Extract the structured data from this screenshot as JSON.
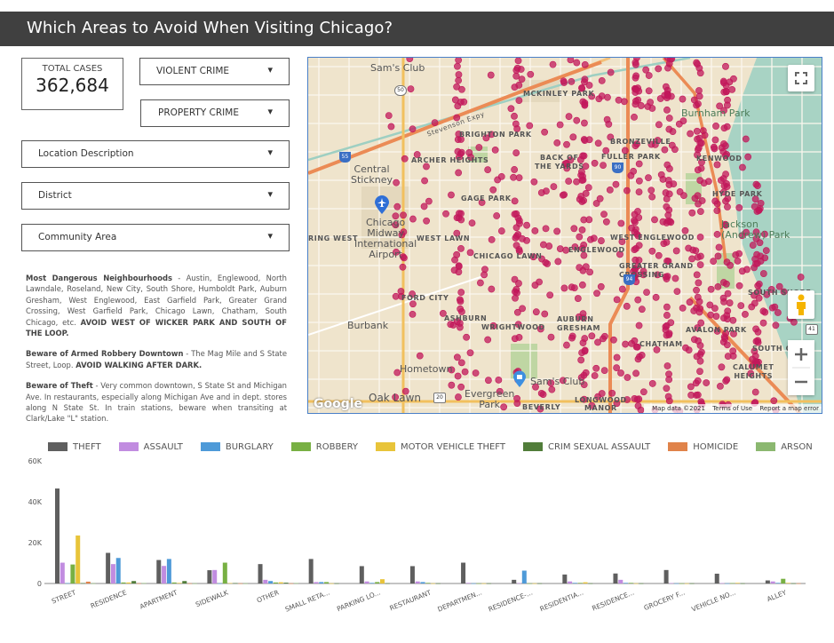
{
  "header": {
    "title": "Which Areas to Avoid When Visiting Chicago?"
  },
  "kpi": {
    "label": "TOTAL CASES",
    "value": "362,684"
  },
  "filters": {
    "violent_crime": {
      "label": "VIOLENT CRIME",
      "chevron": "▾"
    },
    "property_crime": {
      "label": "PROPERTY CRIME",
      "chevron": "▾"
    },
    "location_description": {
      "label": "Location Description",
      "chevron": "▾"
    },
    "district": {
      "label": "District",
      "chevron": "▾"
    },
    "community_area": {
      "label": "Community Area",
      "chevron": "▾"
    }
  },
  "notes": [
    {
      "heading": "Most Dangerous Neighbourhoods",
      "body": " - Austin, Englewood, North Lawndale, Roseland, New City, South Shore, Humboldt Park, Auburn Gresham, West Englewood, East Garfield Park, Greater Grand Crossing, West Garfield Park, Chicago Lawn, Chatham, South Chicago, etc. ",
      "emphasis": "AVOID WEST OF WICKER PARK AND SOUTH OF THE LOOP."
    },
    {
      "heading": "Beware of Armed Robbery Downtown",
      "body": " - The Mag Mile and S State Street, Loop. ",
      "emphasis": "AVOID WALKING AFTER DARK."
    },
    {
      "heading": "Beware of Theft",
      "body": " - Very common downtown, S State St and Michigan Ave. In restaurants, especially along Michigan Ave and in dept. stores along N State St. In train stations, beware when transiting at Clark/Lake \"L\" station.",
      "emphasis": ""
    }
  ],
  "map": {
    "labels": {
      "sams_club_top": "Sam's Club",
      "mckinley_park": "MCKINLEY PARK",
      "burnham_park": "Burnham Park",
      "stevenson_expy": "Stevenson Expy",
      "brighton_park": "BRIGHTON PARK",
      "archer_heights": "ARCHER HEIGHTS",
      "back_of_the_yards": "BACK OF\nTHE YARDS",
      "bronzeville": "BRONZEVILLE",
      "fuller_park": "FULLER PARK",
      "kenwood": "KENWOOD",
      "central_stickney": "Central\nStickney",
      "gage_park": "GAGE PARK",
      "hyde_park": "HYDE PARK",
      "chicago_midway": "Chicago\nMidway\nInternational\nAirport",
      "garfield_ridge": "RING WEST",
      "west_lawn": "WEST LAWN",
      "west_englewood": "WEST ENGLEWOOD",
      "chicago_lawn": "CHICAGO LAWN",
      "jackson_park": "Jackson\n(Andrew) Park",
      "englewood": "ENGLEWOOD",
      "greater_grand_crossing": "GREATER GRAND\nCROSSING",
      "south_shore": "SOUTH SHORE",
      "ford_city": "FORD CITY",
      "ashburn": "ASHBURN",
      "auburn_gresham": "AUBURN\nGRESHAM",
      "avalon_park": "AVALON PARK",
      "burbank": "Burbank",
      "wrightwood": "WRIGHTWOOD",
      "chatham": "CHATHAM",
      "south_chicago": "SOUTH CH",
      "calumet_heights": "CALUMET\nHEIGHTS",
      "hometown": "Hometown",
      "sams_club_bottom": "Sam's Club",
      "oak_lawn": "Oak Lawn",
      "evergreen_park": "Evergreen\nPark",
      "beverly": "BEVERLY",
      "longwood_manor": "LONGWOOD\nMANOR"
    },
    "shields": [
      "50",
      "55",
      "90",
      "94",
      "41",
      "20"
    ],
    "google_logo": "Google",
    "attribution": {
      "map_data": "Map data ©2021",
      "terms": "Terms of Use",
      "report": "Report a map error"
    },
    "marker_color": "#c2185b"
  },
  "legend": [
    {
      "name": "THEFT",
      "color": "#5f5f5f"
    },
    {
      "name": "ASSAULT",
      "color": "#c18ce0"
    },
    {
      "name": "BURGLARY",
      "color": "#4e9ad8"
    },
    {
      "name": "ROBBERY",
      "color": "#78b043"
    },
    {
      "name": "MOTOR VEHICLE THEFT",
      "color": "#e8c43a"
    },
    {
      "name": "CRIM SEXUAL ASSAULT",
      "color": "#517d3a"
    },
    {
      "name": "HOMICIDE",
      "color": "#e0834a"
    },
    {
      "name": "ARSON",
      "color": "#8bb870"
    }
  ],
  "chart_data": {
    "type": "bar",
    "title": "",
    "xlabel": "",
    "ylabel": "",
    "ylim": [
      0,
      60000
    ],
    "yticks": [
      "0",
      "20K",
      "40K",
      "60K"
    ],
    "grid": false,
    "legend_position": "top",
    "categories": [
      "STREET",
      "RESIDENCE",
      "APARTMENT",
      "SIDEWALK",
      "OTHER",
      "SMALL RETA...",
      "PARKING LO...",
      "RESTAURANT",
      "DEPARTMEN...",
      "RESIDENCE-...",
      "RESIDENTIA...",
      "RESIDENCE...",
      "GROCERY F...",
      "VEHICLE NO...",
      "ALLEY"
    ],
    "series": [
      {
        "name": "THEFT",
        "values": [
          46500,
          15000,
          11500,
          6500,
          9500,
          12000,
          8500,
          8500,
          10200,
          1800,
          4400,
          4900,
          6600,
          4800,
          1500
        ]
      },
      {
        "name": "ASSAULT",
        "values": [
          10200,
          9500,
          8600,
          6600,
          1800,
          700,
          1000,
          1000,
          300,
          200,
          1000,
          1800,
          200,
          200,
          1000
        ]
      },
      {
        "name": "BURGLARY",
        "values": [
          200,
          12500,
          12000,
          100,
          1200,
          700,
          300,
          700,
          100,
          6300,
          300,
          300,
          100,
          100,
          300
        ]
      },
      {
        "name": "ROBBERY",
        "values": [
          9300,
          500,
          500,
          10200,
          500,
          700,
          700,
          300,
          100,
          100,
          300,
          300,
          100,
          200,
          2300
        ]
      },
      {
        "name": "MOTOR VEHICLE THEFT",
        "values": [
          23500,
          500,
          300,
          200,
          600,
          100,
          2100,
          100,
          100,
          100,
          600,
          100,
          100,
          300,
          300
        ]
      },
      {
        "name": "CRIM SEXUAL ASSAULT",
        "values": [
          200,
          1200,
          1200,
          200,
          400,
          100,
          100,
          100,
          100,
          100,
          100,
          100,
          100,
          100,
          100
        ]
      },
      {
        "name": "HOMICIDE",
        "values": [
          900,
          100,
          100,
          100,
          100,
          0,
          0,
          0,
          0,
          0,
          0,
          0,
          0,
          0,
          100
        ]
      },
      {
        "name": "ARSON",
        "values": [
          100,
          200,
          100,
          100,
          200,
          0,
          0,
          0,
          0,
          0,
          0,
          0,
          0,
          0,
          0
        ]
      }
    ]
  }
}
